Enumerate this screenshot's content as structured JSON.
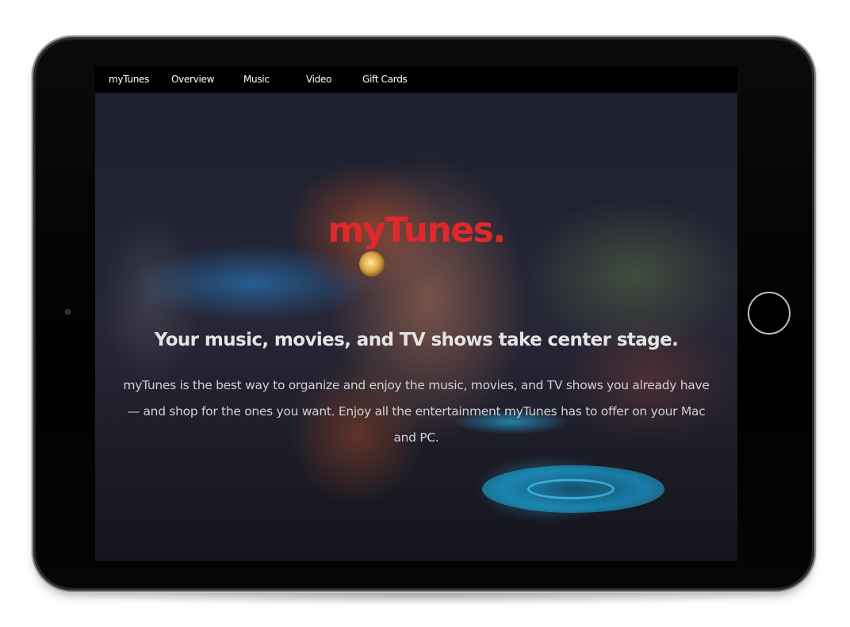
{
  "nav": {
    "brand": "myTunes",
    "items": [
      "Overview",
      "Music",
      "Video",
      "Gift Cards"
    ]
  },
  "hero": {
    "title": "myTunes.",
    "subtitle": "Your music, movies, and TV shows take center stage.",
    "description": "myTunes is the best way to organize and enjoy the music, movies, and TV shows you already have — and shop for the ones you want. Enjoy all the entertainment myTunes has to offer on your Mac and PC."
  },
  "colors": {
    "title_red": "#e0282c",
    "navbar": "#000000",
    "device_bezel": "#000000"
  },
  "icons": {
    "home_button": "home-button-icon",
    "camera": "camera-icon"
  }
}
